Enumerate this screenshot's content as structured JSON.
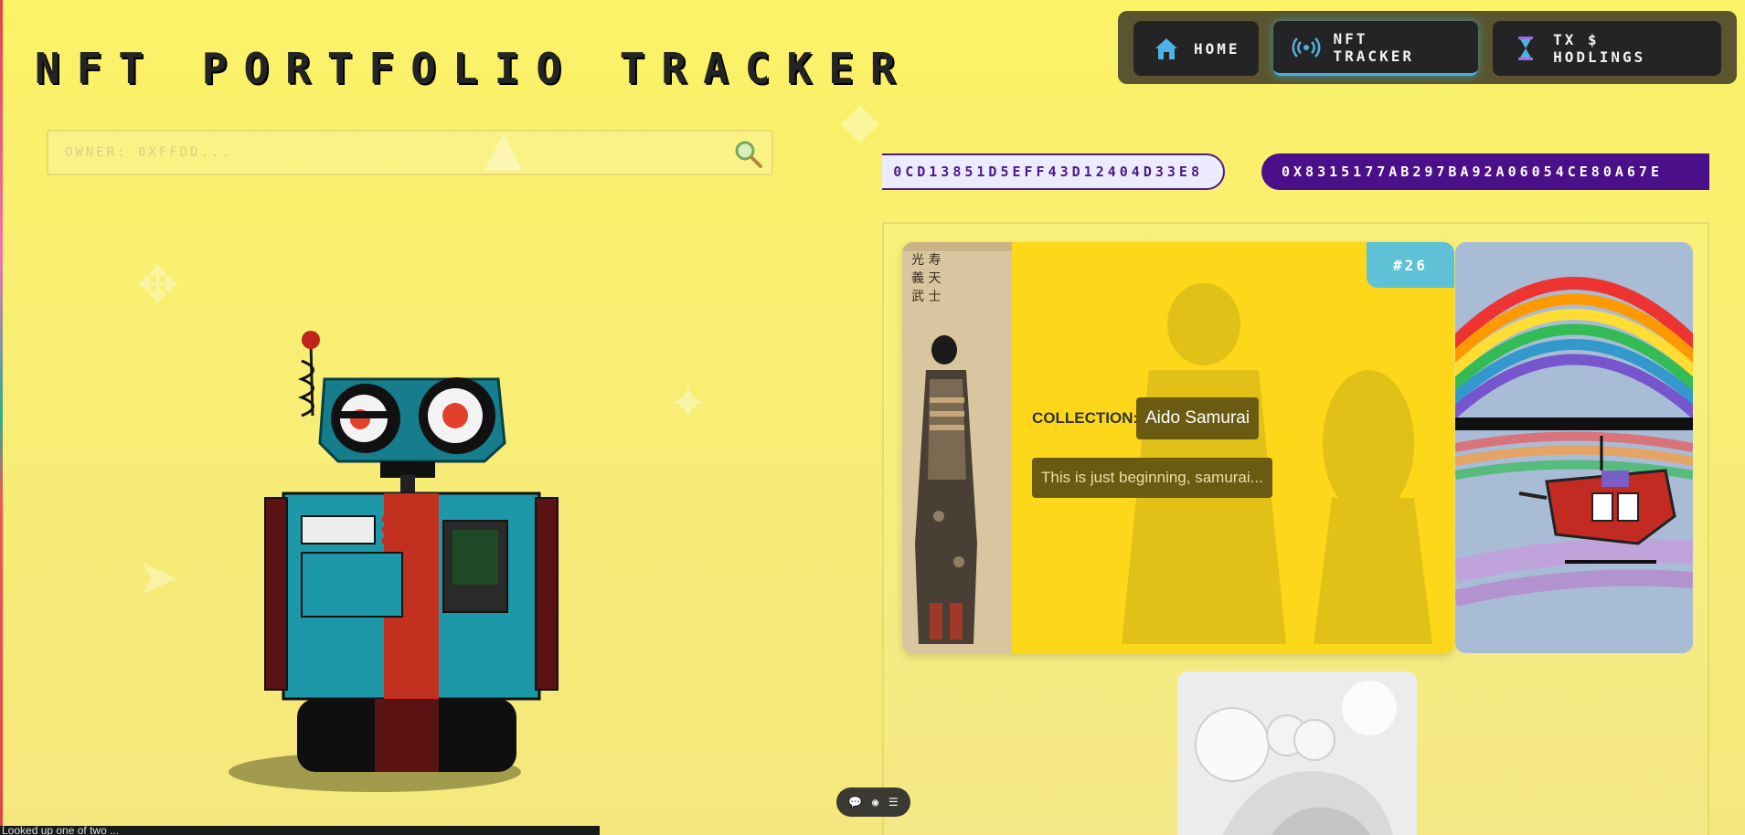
{
  "app": {
    "title": "NFT PORTFOLIO TRACKER"
  },
  "search": {
    "placeholder": "OWNER: 0XFFDD...",
    "value": ""
  },
  "nav": {
    "items": [
      {
        "label": "HOME",
        "icon": "home-icon",
        "active": false
      },
      {
        "label": "NFT TRACKER",
        "icon": "broadcast-icon",
        "active": true
      },
      {
        "label": "TX $ HODLINGS",
        "icon": "hourglass-icon",
        "active": false
      }
    ]
  },
  "ticker": {
    "addresses": [
      "0CD13851D5EFF43D12404D33E8",
      "0X8315177AB297BA92A06054CE80A67E"
    ]
  },
  "nft_cards": [
    {
      "token_id": "#26",
      "collection_label": "COLLECTION:",
      "collection_name": "Aido Samurai",
      "description": "This is just beginning, samurai..."
    }
  ],
  "status_bar": {
    "text": "Looked up one of two ..."
  },
  "colors": {
    "background": "#fbf266",
    "nav_bg": "#5a5530",
    "nav_button": "#242424",
    "accent_blue": "#3fb4e4",
    "purple": "#4b0f8a",
    "card_yellow": "#fcd71a",
    "badge_teal": "#5ec1d6"
  }
}
